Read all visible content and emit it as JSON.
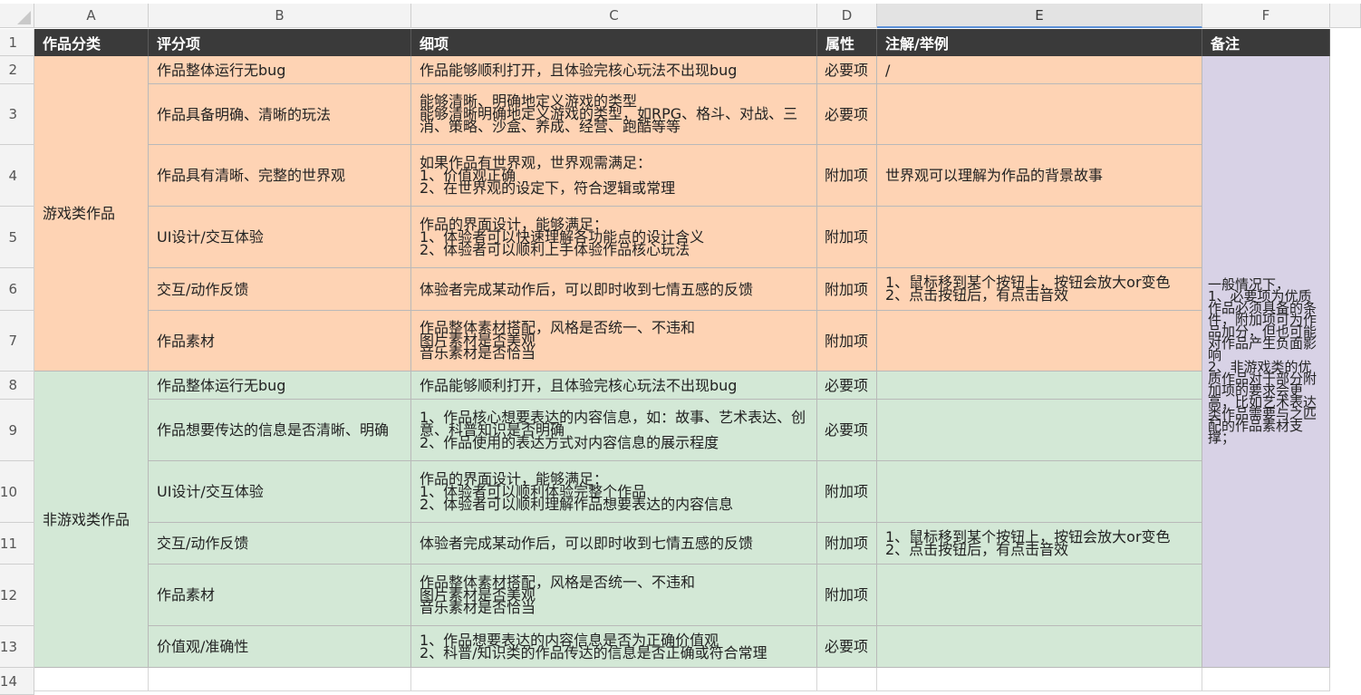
{
  "columns": [
    "A",
    "B",
    "C",
    "D",
    "E",
    "F"
  ],
  "row_numbers": [
    "1",
    "2",
    "3",
    "4",
    "5",
    "6",
    "7",
    "8",
    "9",
    "10",
    "11",
    "12",
    "13",
    "14"
  ],
  "header": {
    "a": "作品分类",
    "b": "评分项",
    "c": "细项",
    "d": "属性",
    "e": "注解/举例",
    "f": "备注"
  },
  "categories": {
    "game": "游戏类作品",
    "nongame": "非游戏类作品"
  },
  "game_rows": [
    {
      "item": "作品整体运行无bug",
      "detail": "作品能够顺利打开，且体验完核心玩法不出现bug",
      "attr": "必要项",
      "note": "/"
    },
    {
      "item": "作品具备明确、清晰的玩法",
      "detail": "能够清晰、明确地定义游戏的类型\n能够清晰明确地定义游戏的类型，如RPG、格斗、对战、三消、策略、沙盒、养成、经营、跑酷等等",
      "attr": "必要项",
      "note": ""
    },
    {
      "item": "作品具有清晰、完整的世界观",
      "detail": "如果作品有世界观，世界观需满足：\n1、价值观正确\n2、在世界观的设定下，符合逻辑或常理",
      "attr": "附加项",
      "note": "世界观可以理解为作品的背景故事"
    },
    {
      "item": "UI设计/交互体验",
      "detail": "作品的界面设计，能够满足：\n1、体验者可以快速理解各功能点的设计含义\n2、体验者可以顺利上手体验作品核心玩法",
      "attr": "附加项",
      "note": ""
    },
    {
      "item": "交互/动作反馈",
      "detail": "体验者完成某动作后，可以即时收到七情五感的反馈",
      "attr": "附加项",
      "note": "1、鼠标移到某个按钮上，按钮会放大or变色\n2、点击按钮后，有点击音效"
    },
    {
      "item": "作品素材",
      "detail": "作品整体素材搭配，风格是否统一、不违和\n图片素材是否美观\n音乐素材是否恰当",
      "attr": "附加项",
      "note": ""
    }
  ],
  "nongame_rows": [
    {
      "item": "作品整体运行无bug",
      "detail": "作品能够顺利打开，且体验完核心玩法不出现bug",
      "attr": "必要项",
      "note": ""
    },
    {
      "item": "作品想要传达的信息是否清晰、明确",
      "detail": "1、作品核心想要表达的内容信息，如：故事、艺术表达、创意、科普知识是否明确\n2、作品使用的表达方式对内容信息的展示程度",
      "attr": "必要项",
      "note": ""
    },
    {
      "item": "UI设计/交互体验",
      "detail": "作品的界面设计，能够满足：\n1、体验者可以顺利体验完整个作品\n2、体验者可以顺利理解作品想要表达的内容信息",
      "attr": "附加项",
      "note": ""
    },
    {
      "item": "交互/动作反馈",
      "detail": "体验者完成某动作后，可以即时收到七情五感的反馈",
      "attr": "附加项",
      "note": "1、鼠标移到某个按钮上，按钮会放大or变色\n2、点击按钮后，有点击音效"
    },
    {
      "item": "作品素材",
      "detail": "作品整体素材搭配，风格是否统一、不违和\n图片素材是否美观\n音乐素材是否恰当",
      "attr": "附加项",
      "note": ""
    },
    {
      "item": "价值观/准确性",
      "detail": "1、作品想要表达的内容信息是否为正确价值观\n2、科普/知识类的作品传达的信息是否正确或符合常理",
      "attr": "必要项",
      "note": ""
    }
  ],
  "remark": "一般情况下，\n1、必要项为优质作品必须具备的条件，附加项可为作品加分，但也可能对作品产生负面影响\n2、非游戏类的优质作品对于部分附加项的要求会更高，比如艺术表达类作品需要与之匹配的作品素材支撑；",
  "colors": {
    "header_bg": "#3a3a3a",
    "game_bg": "#fed3b4",
    "nongame_bg": "#d3e8d6",
    "remark_bg": "#d8d2e6",
    "selected_column_accent": "#5b8fd6"
  }
}
